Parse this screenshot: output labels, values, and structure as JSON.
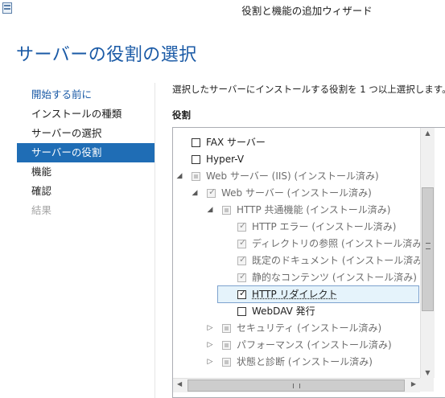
{
  "window": {
    "title": "役割と機能の追加ウィザード"
  },
  "page": {
    "title": "サーバーの役割の選択"
  },
  "nav": {
    "items": [
      {
        "label": "開始する前に",
        "state": "link"
      },
      {
        "label": "インストールの種類",
        "state": "normal"
      },
      {
        "label": "サーバーの選択",
        "state": "normal"
      },
      {
        "label": "サーバーの役割",
        "state": "active"
      },
      {
        "label": "機能",
        "state": "normal"
      },
      {
        "label": "確認",
        "state": "normal"
      },
      {
        "label": "結果",
        "state": "disabled"
      }
    ]
  },
  "content": {
    "instruction": "選択したサーバーにインストールする役割を 1 つ以上選択します。",
    "roles_heading": "役割"
  },
  "roles": [
    {
      "label": "FAX サーバー",
      "level": 0,
      "expander": "none",
      "check": "unchecked",
      "disabled": false
    },
    {
      "label": "Hyper-V",
      "level": 0,
      "expander": "none",
      "check": "unchecked",
      "disabled": false
    },
    {
      "label": "Web サーバー (IIS) (インストール済み)",
      "level": 0,
      "expander": "expanded",
      "check": "indeterminate",
      "disabled": true
    },
    {
      "label": "Web サーバー (インストール済み)",
      "level": 1,
      "expander": "expanded",
      "check": "checked",
      "disabled": true
    },
    {
      "label": "HTTP 共通機能 (インストール済み)",
      "level": 2,
      "expander": "expanded",
      "check": "indeterminate",
      "disabled": true
    },
    {
      "label": "HTTP エラー (インストール済み)",
      "level": 3,
      "expander": "none",
      "check": "checked",
      "disabled": true
    },
    {
      "label": "ディレクトリの参照 (インストール済み)",
      "level": 3,
      "expander": "none",
      "check": "checked",
      "disabled": true
    },
    {
      "label": "既定のドキュメント (インストール済み)",
      "level": 3,
      "expander": "none",
      "check": "checked",
      "disabled": true
    },
    {
      "label": "静的なコンテンツ (インストール済み)",
      "level": 3,
      "expander": "none",
      "check": "checked",
      "disabled": true
    },
    {
      "label": "HTTP リダイレクト",
      "level": 3,
      "expander": "none",
      "check": "checked",
      "disabled": false,
      "selected": true
    },
    {
      "label": "WebDAV 発行",
      "level": 3,
      "expander": "none",
      "check": "unchecked",
      "disabled": false
    },
    {
      "label": "セキュリティ (インストール済み)",
      "level": 2,
      "expander": "collapsed",
      "check": "indeterminate",
      "disabled": true
    },
    {
      "label": "パフォーマンス (インストール済み)",
      "level": 2,
      "expander": "collapsed",
      "check": "indeterminate",
      "disabled": true
    },
    {
      "label": "状態と診断 (インストール済み)",
      "level": 2,
      "expander": "collapsed",
      "check": "indeterminate",
      "disabled": true
    }
  ],
  "icons": {
    "app": "server-manager-icon",
    "expanded": "triangle-down-icon",
    "collapsed": "triangle-right-icon"
  },
  "colors": {
    "accent": "#1f6db5",
    "title_text": "#1a5aa6",
    "selection_bg": "#e5f3fb",
    "selection_border": "#7da2ce"
  }
}
